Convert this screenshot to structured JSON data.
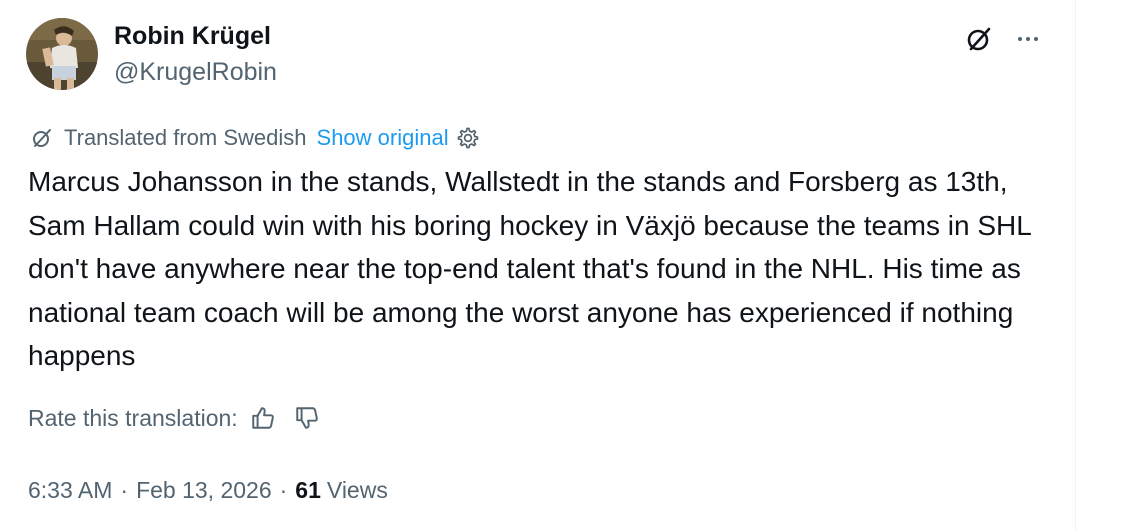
{
  "author": {
    "display_name": "Robin Krügel",
    "handle": "@KrugelRobin"
  },
  "header_actions": {
    "grok_icon": "grok-icon",
    "more_icon": "more-icon"
  },
  "translation": {
    "notice": "Translated from Swedish",
    "show_original": "Show original",
    "translate_icon": "grok-icon",
    "settings_icon": "gear-icon"
  },
  "tweet": {
    "text": "Marcus Johansson in the stands, Wallstedt in the stands and Forsberg as 13th, Sam Hallam could win with his boring hockey in Växjö because the teams in SHL don't have anywhere near the top-end talent that's found in the NHL. His time as national team coach will be among the worst anyone has experienced if nothing happens"
  },
  "rating": {
    "label": "Rate this translation:",
    "thumbs_up_icon": "thumbs-up-icon",
    "thumbs_down_icon": "thumbs-down-icon"
  },
  "meta": {
    "time": "6:33 AM",
    "separator": "·",
    "date": "Feb 13, 2026",
    "views_count": "61",
    "views_label": "Views"
  },
  "colors": {
    "text_primary": "#0f1419",
    "text_secondary": "#536471",
    "link": "#1d9bf0",
    "border": "#eff3f4"
  }
}
